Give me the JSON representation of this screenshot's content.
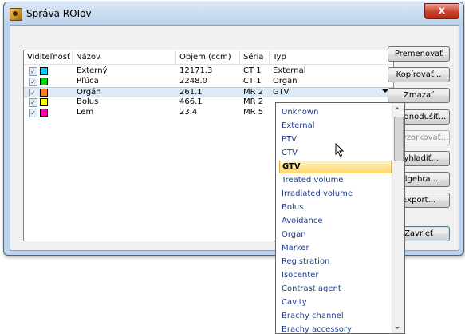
{
  "window": {
    "title": "Správa ROIov",
    "close_glyph": "x"
  },
  "columns": [
    "Viditeľnosť",
    "Názov",
    "Objem (ccm)",
    "Séria",
    "Typ"
  ],
  "rows": [
    {
      "visible": true,
      "color": "#00d2ff",
      "name": "Externý",
      "volume": "12171.3",
      "series": "CT 1",
      "type": "External"
    },
    {
      "visible": true,
      "color": "#00d000",
      "name": "Pľúca",
      "volume": "2248.0",
      "series": "CT 1",
      "type": "Organ"
    },
    {
      "visible": true,
      "color": "#ff7a20",
      "name": "Orgán",
      "volume": "261.1",
      "series": "MR 2",
      "type": "GTV"
    },
    {
      "visible": true,
      "color": "#ffff00",
      "name": "Bolus",
      "volume": "466.1",
      "series": "MR 2",
      "type": ""
    },
    {
      "visible": true,
      "color": "#ff00a8",
      "name": "Lem",
      "volume": "23.4",
      "series": "MR 5",
      "type": ""
    }
  ],
  "checkmark": "✓",
  "buttons": {
    "rename": "Premenovať",
    "copy": "Kopírovať...",
    "delete": "Zmazať",
    "simplify": "Zjednodušiť...",
    "resample": "Prevzorkovať...",
    "smooth": "Vyhladiť...",
    "algebra": "Algebra...",
    "export": "Export...",
    "close": "Zavrieť"
  },
  "dropdown": {
    "selected": "GTV",
    "options": [
      "Unknown",
      "External",
      "PTV",
      "CTV",
      "GTV",
      "Treated volume",
      "Irradiated volume",
      "Bolus",
      "Avoidance",
      "Organ",
      "Marker",
      "Registration",
      "Isocenter",
      "Contrast agent",
      "Cavity",
      "Brachy channel",
      "Brachy accessory"
    ]
  }
}
